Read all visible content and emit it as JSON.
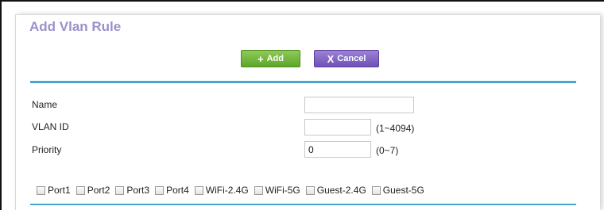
{
  "form": {
    "title": "Add Vlan Rule"
  },
  "buttons": {
    "add_icon": "+",
    "add_label": "Add",
    "cancel_icon": "X",
    "cancel_label": "Cancel"
  },
  "fields": {
    "name_label": "Name",
    "name_value": "",
    "vlan_id_label": "VLAN ID",
    "vlan_id_value": "",
    "vlan_id_hint": "(1~4094)",
    "priority_label": "Priority",
    "priority_value": "0",
    "priority_hint": "(0~7)"
  },
  "ports": [
    {
      "label": "Port1",
      "checked": false
    },
    {
      "label": "Port2",
      "checked": false
    },
    {
      "label": "Port3",
      "checked": false
    },
    {
      "label": "Port4",
      "checked": false
    },
    {
      "label": "WiFi-2.4G",
      "checked": false
    },
    {
      "label": "WiFi-5G",
      "checked": false
    },
    {
      "label": "Guest-2.4G",
      "checked": false
    },
    {
      "label": "Guest-5G",
      "checked": false
    }
  ],
  "colors": {
    "title": "#9a91c9",
    "add_button": "#6fb33a",
    "cancel_button": "#7b5fc4",
    "divider": "#46a6cc"
  }
}
